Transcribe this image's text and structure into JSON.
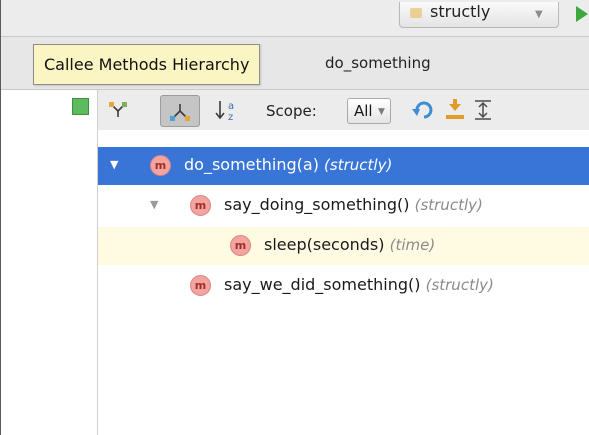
{
  "top_bar": {
    "branch_label": "structly",
    "run_icon": "run-icon"
  },
  "window": {
    "title": "do_something"
  },
  "tooltip": {
    "text": "Callee Methods Hierarchy"
  },
  "toolbar": {
    "buttons": [
      "caller-hierarchy-icon",
      "callee-hierarchy-icon",
      "sort-alphabetically-icon"
    ],
    "scope_label": "Scope:",
    "scope_value": "All",
    "actions": [
      "refresh-icon",
      "export-icon",
      "expand-all-icon"
    ]
  },
  "tree": {
    "nodes": [
      {
        "icon": "m",
        "name": "do_something(a)",
        "pkg": "(structly)",
        "selected": true,
        "expanded": true
      },
      {
        "icon": "m",
        "name": "say_doing_something()",
        "pkg": "(structly)",
        "expanded": true
      },
      {
        "icon": "m",
        "name": "sleep(seconds)",
        "pkg": "(time)",
        "highlighted": true
      },
      {
        "icon": "m",
        "name": "say_we_did_something()",
        "pkg": "(structly)"
      }
    ]
  },
  "colors": {
    "selection": "#3875d7",
    "highlight": "#fffbe3",
    "tooltip_bg": "#fbf5c4",
    "method_icon": "#f3a3a0"
  }
}
